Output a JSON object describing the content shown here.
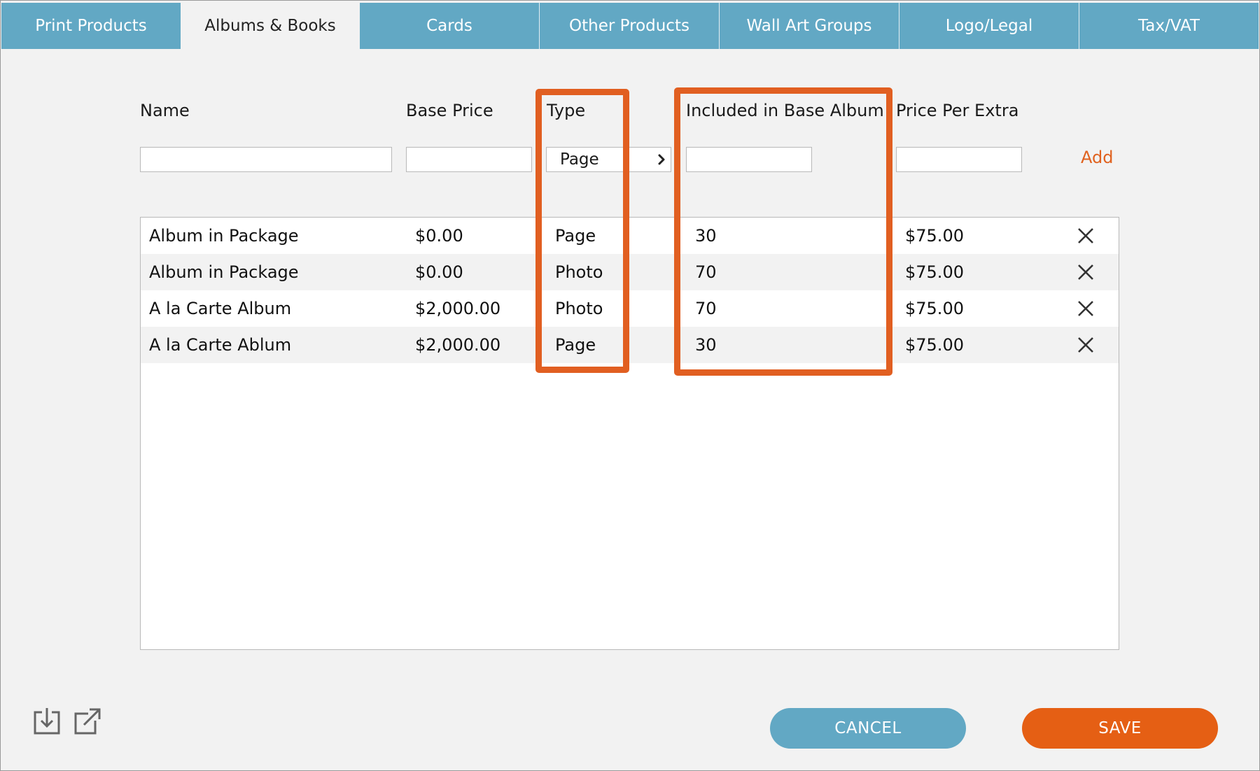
{
  "tabs": [
    {
      "label": "Print Products"
    },
    {
      "label": "Albums & Books"
    },
    {
      "label": "Cards"
    },
    {
      "label": "Other Products"
    },
    {
      "label": "Wall Art Groups"
    },
    {
      "label": "Logo/Legal"
    },
    {
      "label": "Tax/VAT"
    }
  ],
  "active_tab": "Albums & Books",
  "columns": {
    "name": "Name",
    "base_price": "Base Price",
    "type": "Type",
    "included": "Included in Base Album",
    "price_per_extra": "Price Per Extra"
  },
  "form": {
    "name_value": "",
    "base_price_value": "",
    "type_value": "Page",
    "included_value": "",
    "price_per_extra_value": "",
    "add_label": "Add"
  },
  "rows": [
    {
      "name": "Album in Package",
      "base_price": "$0.00",
      "type": "Page",
      "included": "30",
      "price_per_extra": "$75.00"
    },
    {
      "name": "Album in Package",
      "base_price": "$0.00",
      "type": "Photo",
      "included": "70",
      "price_per_extra": "$75.00"
    },
    {
      "name": "A la Carte Album",
      "base_price": "$2,000.00",
      "type": "Photo",
      "included": "70",
      "price_per_extra": "$75.00"
    },
    {
      "name": "A la Carte Ablum",
      "base_price": "$2,000.00",
      "type": "Page",
      "included": "30",
      "price_per_extra": "$75.00"
    }
  ],
  "buttons": {
    "cancel": "CANCEL",
    "save": "SAVE"
  },
  "icons": {
    "delete": "close-x-icon",
    "import": "import-icon",
    "export": "export-icon",
    "dropdown": "chevron-right-icon"
  },
  "colors": {
    "tab_bar": "#62a8c4",
    "accent": "#e55f14",
    "highlight": "#e15f21",
    "background": "#f2f2f2"
  }
}
